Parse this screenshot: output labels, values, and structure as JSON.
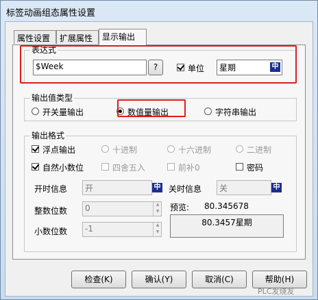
{
  "window": {
    "title": "标签动画组态属性设置"
  },
  "tabs": [
    {
      "label": "属性设置"
    },
    {
      "label": "扩展属性"
    },
    {
      "label": "显示输出"
    }
  ],
  "expression": {
    "legend": "表达式",
    "value": "$Week",
    "browse_label": "?",
    "unit_label": "单位",
    "unit_checked": true,
    "unit_value": "星期",
    "ime_icon_label": "中"
  },
  "output_type": {
    "legend": "输出值类型",
    "options": [
      {
        "label": "开关量输出",
        "selected": false
      },
      {
        "label": "数值量输出",
        "selected": true
      },
      {
        "label": "字符串输出",
        "selected": false
      }
    ]
  },
  "format": {
    "legend": "输出格式",
    "float_label": "浮点输出",
    "decimal_label": "十进制",
    "hex_label": "十六进制",
    "binary_label": "二进制",
    "natural_label": "自然小数位",
    "round_label": "四舍五入",
    "pad_label": "前补0",
    "password_label": "密码",
    "on_label": "开时信息",
    "on_value": "开",
    "off_label": "关时信息",
    "off_value": "关",
    "int_digits_label": "整数位数",
    "int_digits_value": "0",
    "dec_digits_label": "小数位数",
    "dec_digits_value": "-1",
    "preview_label": "预览:",
    "preview_value": "80.345678",
    "preview_box": "80.3457星期"
  },
  "buttons": {
    "check": "检查(K)",
    "ok": "确认(Y)",
    "cancel": "取消(C)",
    "help": "帮助(H)"
  },
  "watermark": "PLC发烧友"
}
